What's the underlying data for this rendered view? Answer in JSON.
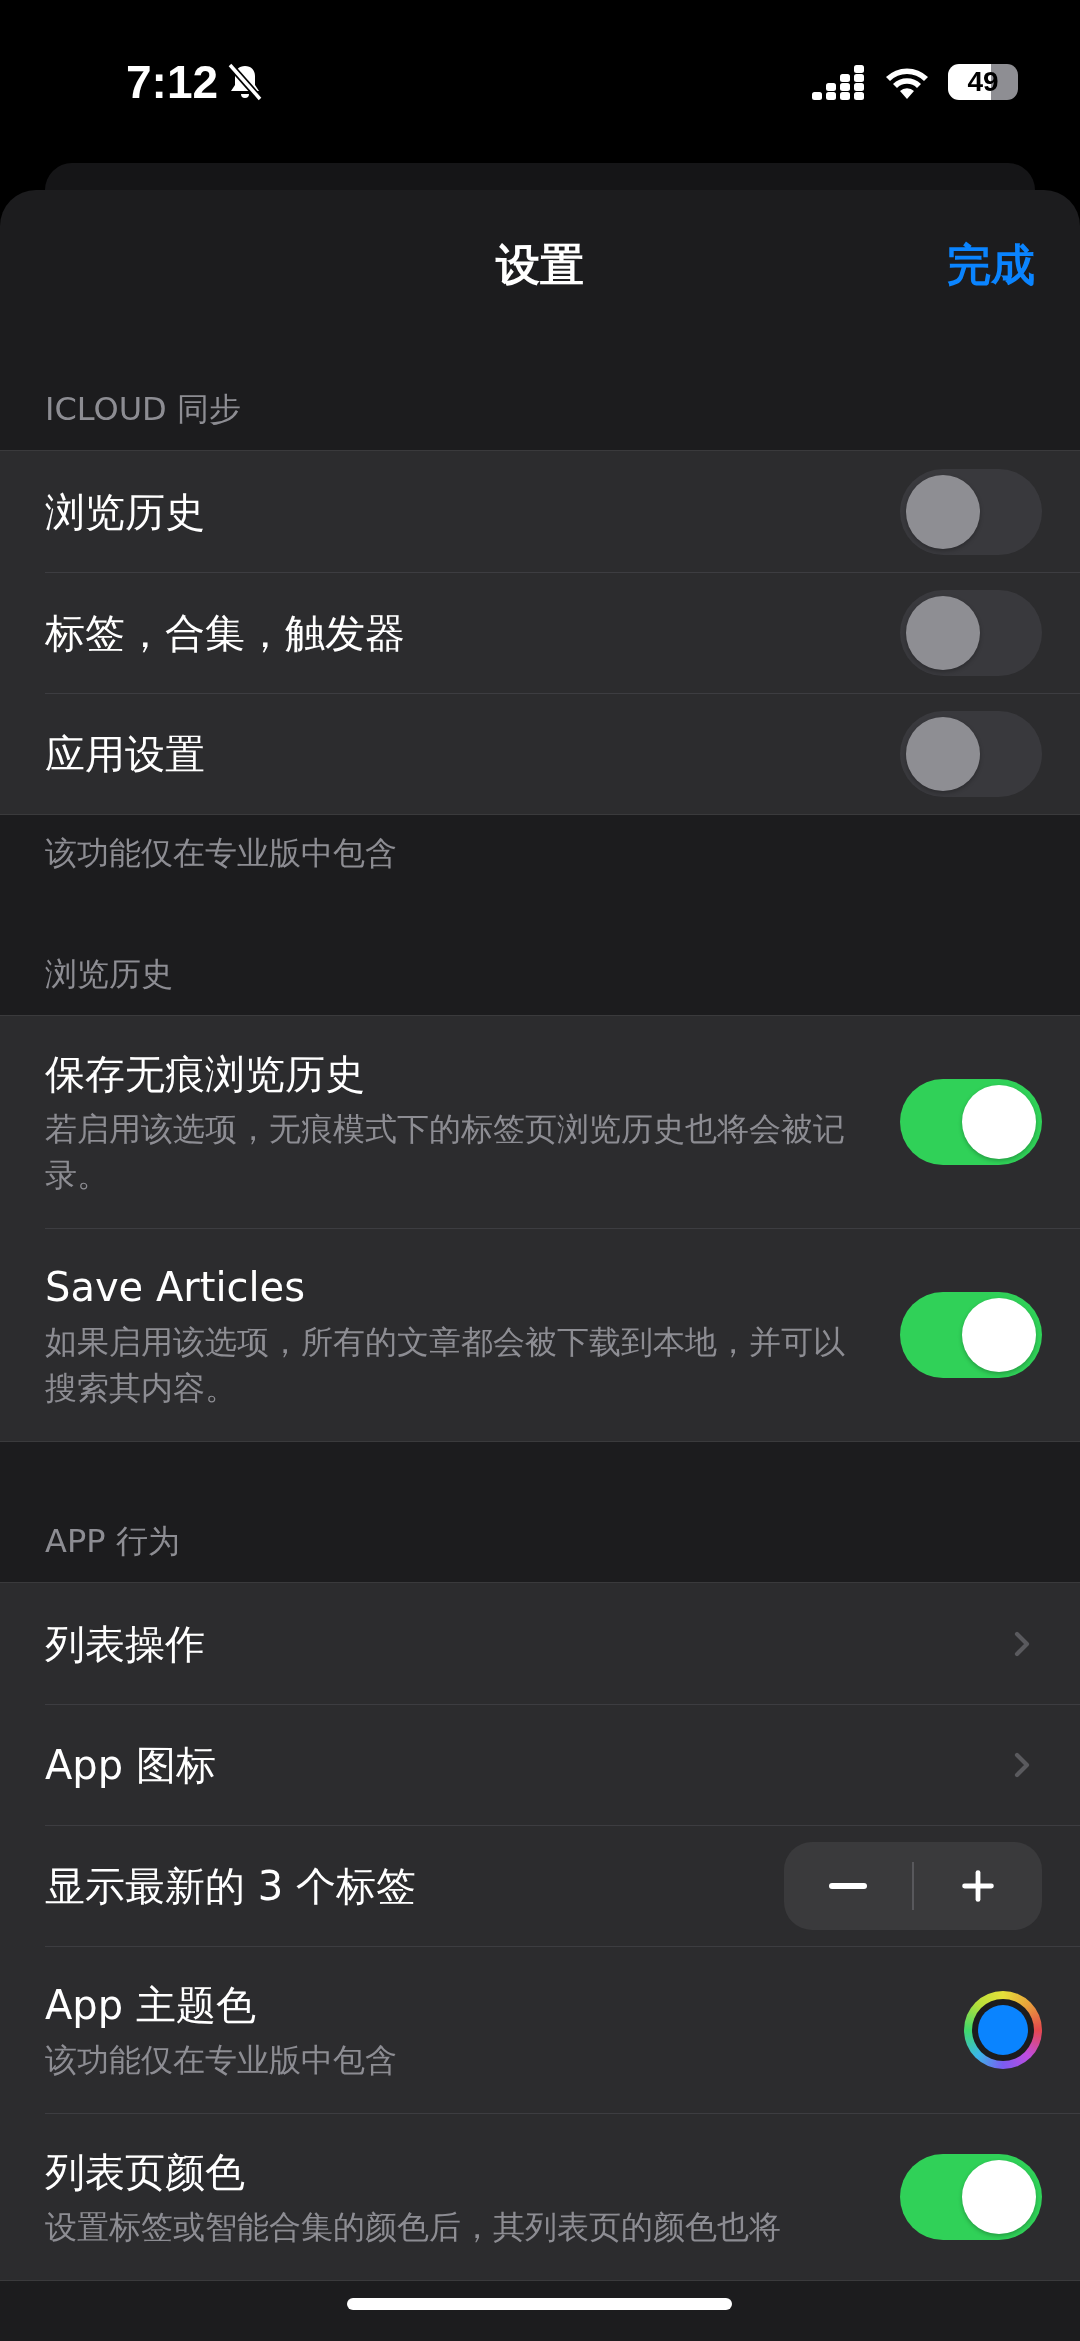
{
  "status_bar": {
    "time": "7:12",
    "silent": true,
    "battery": "49"
  },
  "nav": {
    "title": "设置",
    "done": "完成"
  },
  "sections": [
    {
      "header": "ICLOUD 同步",
      "footer": "该功能仅在专业版中包含",
      "rows": [
        {
          "kind": "toggle",
          "title": "浏览历史",
          "on": false,
          "disabled": true
        },
        {
          "kind": "toggle",
          "title": "标签，合集，触发器",
          "on": false,
          "disabled": true
        },
        {
          "kind": "toggle",
          "title": "应用设置",
          "on": false,
          "disabled": true
        }
      ]
    },
    {
      "header": "浏览历史",
      "rows": [
        {
          "kind": "toggle",
          "title": "保存无痕浏览历史",
          "subtitle": "若启用该选项，无痕模式下的标签页浏览历史也将会被记录。",
          "on": true,
          "disabled": false
        },
        {
          "kind": "toggle",
          "title": "Save Articles",
          "subtitle": "如果启用该选项，所有的文章都会被下载到本地，并可以搜索其内容。",
          "on": true,
          "disabled": false
        }
      ]
    },
    {
      "header": "APP 行为",
      "rows": [
        {
          "kind": "link",
          "title": "列表操作"
        },
        {
          "kind": "link",
          "title": "App 图标"
        },
        {
          "kind": "stepper",
          "title": "显示最新的 3 个标签"
        },
        {
          "kind": "color",
          "title": "App 主题色",
          "subtitle": "该功能仅在专业版中包含",
          "color": "#0a84ff"
        },
        {
          "kind": "toggle",
          "title": "列表页颜色",
          "subtitle": "设置标签或智能合集的颜色后，其列表页的颜色也将",
          "on": true,
          "disabled": false
        }
      ]
    }
  ]
}
